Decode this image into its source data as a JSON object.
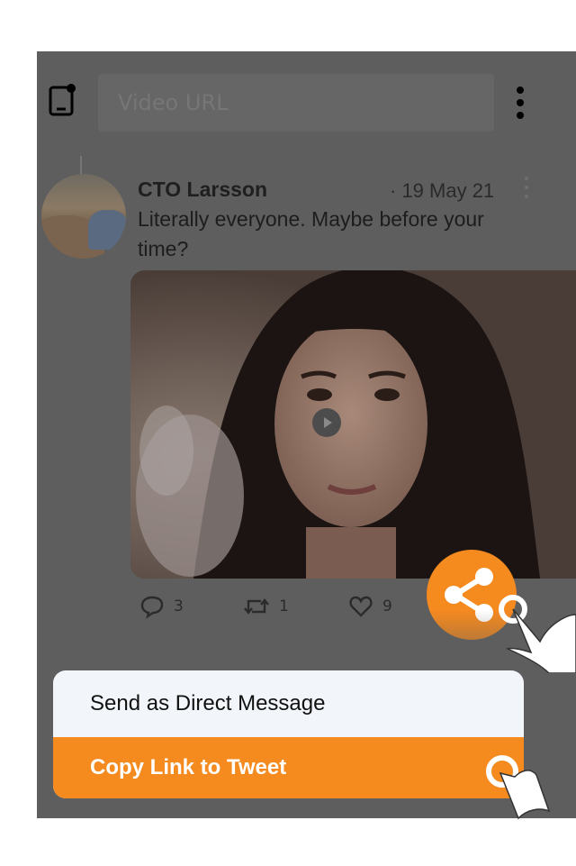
{
  "toolbar": {
    "url_placeholder": "Video URL",
    "paste_icon": "phone-paste-icon",
    "more_icon": "more-vertical-icon"
  },
  "tweet": {
    "author": "CTO Larsson",
    "date": "· 19 May 21",
    "text": "Literally everyone. Maybe before your time?",
    "media_type": "video",
    "replies": "3",
    "retweets": "1",
    "likes": "9"
  },
  "share_menu": {
    "items": [
      {
        "label": "Send as Direct Message"
      },
      {
        "label": "Copy Link to Tweet"
      }
    ]
  },
  "colors": {
    "accent": "#f58a1f",
    "overlay": "#5e5e5e",
    "menu_bg": "#f2f6fb"
  }
}
